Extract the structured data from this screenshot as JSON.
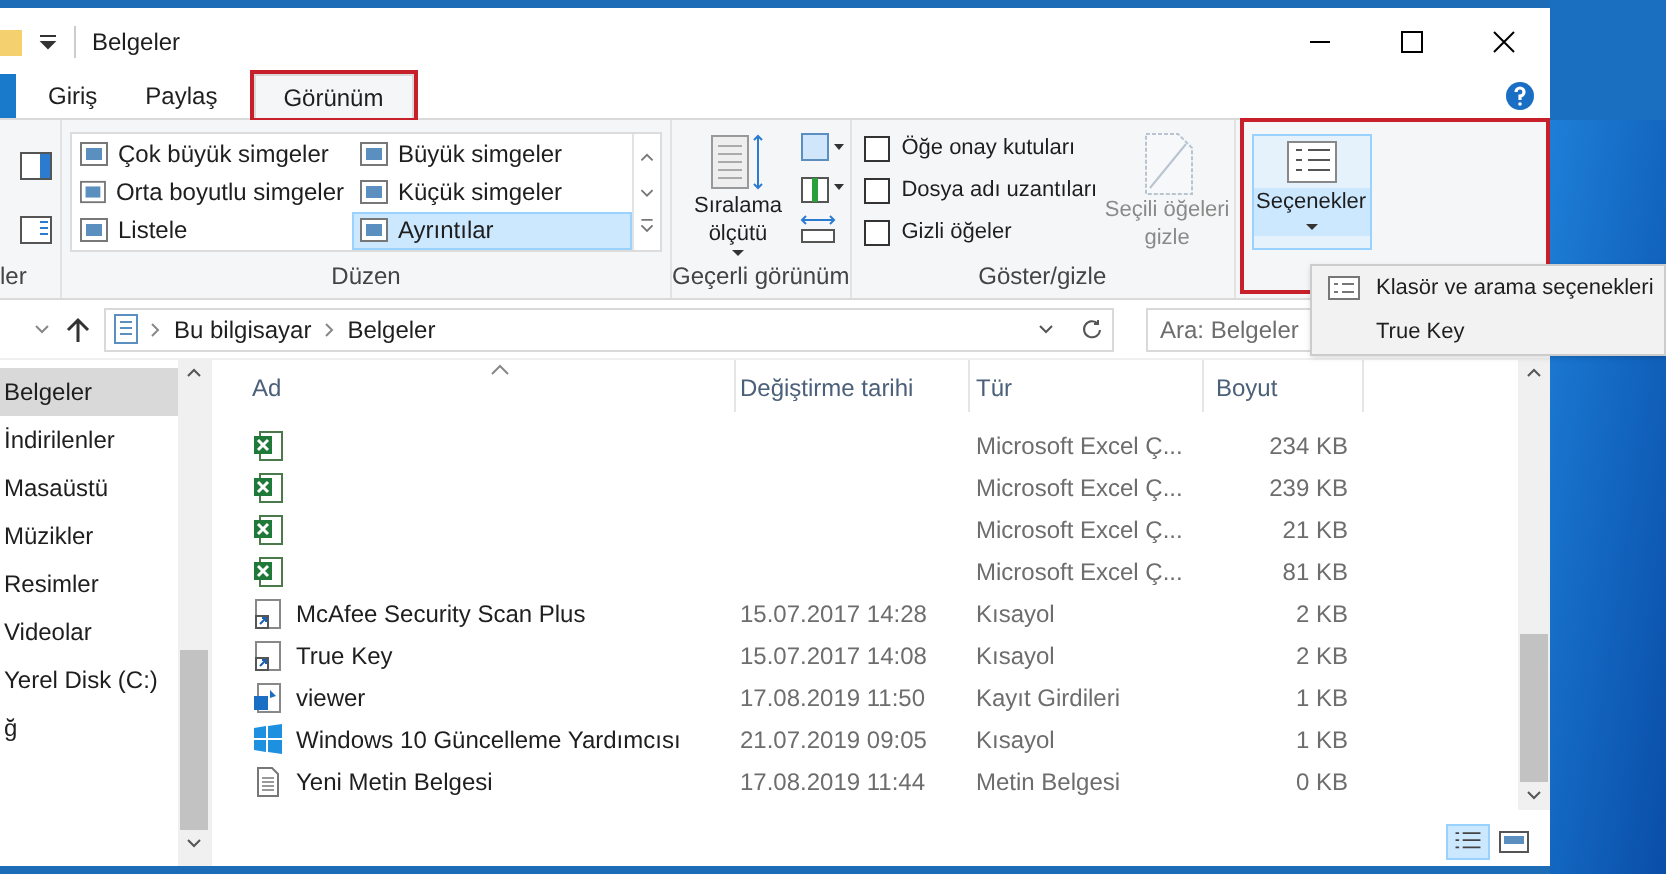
{
  "window": {
    "title": "Belgeler"
  },
  "tabs": [
    {
      "label": "Giriş",
      "selected": false,
      "highlighted": false
    },
    {
      "label": "Paylaş",
      "selected": false,
      "highlighted": false
    },
    {
      "label": "Görünüm",
      "selected": true,
      "highlighted": true
    }
  ],
  "ribbon": {
    "panes_group": {
      "label": "ler"
    },
    "layout_group": {
      "label": "Düzen",
      "items": [
        {
          "label": "Çok büyük simgeler",
          "selected": false
        },
        {
          "label": "Büyük simgeler",
          "selected": false
        },
        {
          "label": "Orta boyutlu simgeler",
          "selected": false
        },
        {
          "label": "Küçük simgeler",
          "selected": false
        },
        {
          "label": "Listele",
          "selected": false
        },
        {
          "label": "Ayrıntılar",
          "selected": true
        }
      ]
    },
    "current_view_group": {
      "label": "Geçerli görünüm",
      "sort_button": "Sıralama ölçütü"
    },
    "show_hide_group": {
      "label": "Göster/gizle",
      "checkboxes": [
        {
          "label": "Öğe onay kutuları",
          "checked": false
        },
        {
          "label": "Dosya adı uzantıları",
          "checked": false
        },
        {
          "label": "Gizli öğeler",
          "checked": false
        }
      ],
      "hide_selected": "Seçili öğeleri gizle"
    },
    "options_group": {
      "button": "Seçenekler",
      "highlighted": true,
      "menu": [
        {
          "label": "Klasör ve arama seçenekleri"
        },
        {
          "label": "True Key"
        }
      ]
    }
  },
  "address_bar": {
    "path": [
      "Bu bilgisayar",
      "Belgeler"
    ]
  },
  "search": {
    "placeholder": "Ara: Belgeler"
  },
  "sidebar": {
    "items": [
      {
        "label": "Belgeler",
        "selected": true
      },
      {
        "label": "İndirilenler",
        "selected": false
      },
      {
        "label": "Masaüstü",
        "selected": false
      },
      {
        "label": "Müzikler",
        "selected": false
      },
      {
        "label": "Resimler",
        "selected": false
      },
      {
        "label": "Videolar",
        "selected": false
      },
      {
        "label": "Yerel Disk (C:)",
        "selected": false
      },
      {
        "label": "ğ",
        "selected": false
      }
    ]
  },
  "table": {
    "columns": [
      "Ad",
      "Değiştirme tarihi",
      "Tür",
      "Boyut"
    ],
    "rows": [
      {
        "kind": "excel",
        "name": "",
        "date": "",
        "type": "Microsoft Excel Ç...",
        "size": "234 KB"
      },
      {
        "kind": "excel",
        "name": "",
        "date": "",
        "type": "Microsoft Excel Ç...",
        "size": "239 KB"
      },
      {
        "kind": "excel",
        "name": "",
        "date": "",
        "type": "Microsoft Excel Ç...",
        "size": "21 KB"
      },
      {
        "kind": "excel",
        "name": "",
        "date": "",
        "type": "Microsoft Excel Ç...",
        "size": "81 KB"
      },
      {
        "kind": "shortcut",
        "name": "McAfee Security Scan Plus",
        "date": "15.07.2017 14:28",
        "type": "Kısayol",
        "size": "2 KB"
      },
      {
        "kind": "shortcut",
        "name": "True Key",
        "date": "15.07.2017 14:08",
        "type": "Kısayol",
        "size": "2 KB"
      },
      {
        "kind": "registry",
        "name": "viewer",
        "date": "17.08.2019 11:50",
        "type": "Kayıt Girdileri",
        "size": "1 KB"
      },
      {
        "kind": "windows",
        "name": "Windows 10 Güncelleme Yardımcısı",
        "date": "21.07.2019 09:05",
        "type": "Kısayol",
        "size": "1 KB"
      },
      {
        "kind": "text",
        "name": "Yeni Metin Belgesi",
        "date": "17.08.2019 11:44",
        "type": "Metin Belgesi",
        "size": "0 KB"
      }
    ]
  }
}
